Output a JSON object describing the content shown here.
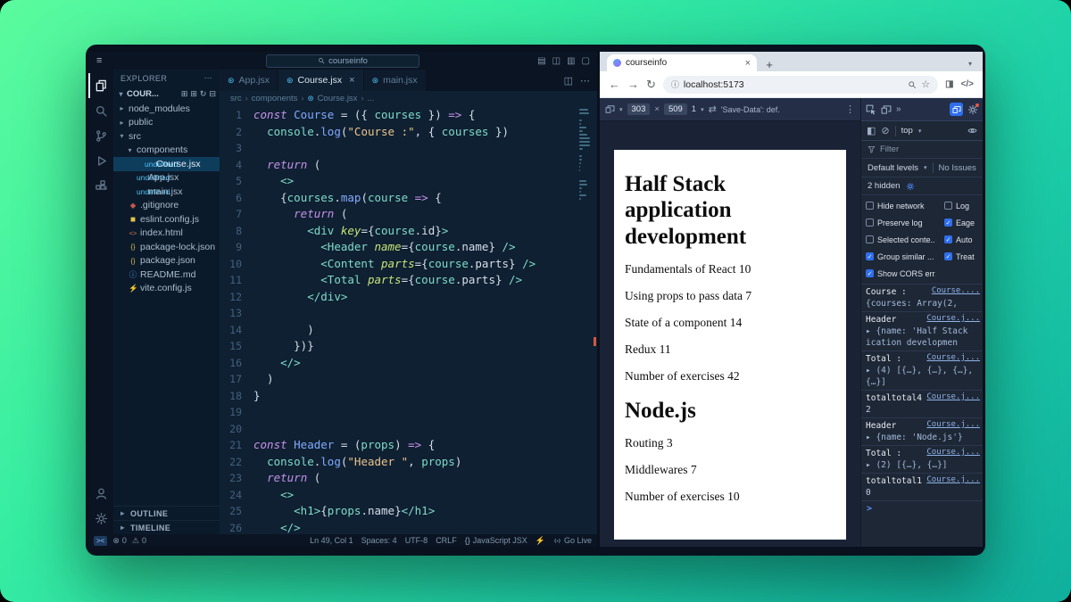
{
  "icons": {
    "menu": "≡",
    "chev_r": "▸",
    "chev_d": "▾",
    "crumb_sep": "›",
    "close": "×",
    "add": "+",
    "more_h": "⋯",
    "more_v": "⋮",
    "split": "◫",
    "layout_a": "▤",
    "layout_b": "◫",
    "layout_c": "▥",
    "layout_d": "▢",
    "back": "←",
    "forward": "→",
    "reload": "↻",
    "site_info": "ⓘ",
    "star": "☆",
    "code": "</>",
    "side_panel": "◨",
    "errors": "⊗",
    "warnings": "⚠",
    "braces": "{}",
    "bolt": "⚡",
    "react": "⊛",
    "x": "×",
    "dbl_arrow": "»",
    "rotate": "⇄",
    "clear": "⊘",
    "sidebar_panel": "◧",
    "remote": "><",
    "new_file": "⊞",
    "new_folder": "⊞",
    "refresh": "↻",
    "collapse": "⊟",
    "file_js": "◼",
    "file_json": "{}",
    "file_html": "<>",
    "file_info": "ⓘ",
    "file_vite": "⚡",
    "file_git": "◆"
  },
  "vscode": {
    "search_text": "courseinfo",
    "activity_top": [
      {
        "name": "files",
        "active": true
      },
      {
        "name": "search"
      },
      {
        "name": "scm"
      },
      {
        "name": "debug"
      },
      {
        "name": "ext"
      }
    ],
    "activity_bottom": [
      {
        "name": "account"
      },
      {
        "name": "gear"
      }
    ],
    "explorer": {
      "title": "EXPLORER",
      "project": "COUR...",
      "tree": [
        {
          "label": "node_modules",
          "indent": 0,
          "chev": "r"
        },
        {
          "label": "public",
          "indent": 0,
          "chev": "r"
        },
        {
          "label": "src",
          "indent": 0,
          "chev": "d"
        },
        {
          "label": "components",
          "indent": 1,
          "chev": "d"
        },
        {
          "label": "Course.jsx",
          "indent": 2,
          "icon": "react",
          "selected": true
        },
        {
          "label": "App.jsx",
          "indent": 1,
          "icon": "react"
        },
        {
          "label": "main.jsx",
          "indent": 1,
          "icon": "react"
        },
        {
          "label": ".gitignore",
          "indent": 0,
          "icon": "git"
        },
        {
          "label": "eslint.config.js",
          "indent": 0,
          "icon": "js"
        },
        {
          "label": "index.html",
          "indent": 0,
          "icon": "html"
        },
        {
          "label": "package-lock.json",
          "indent": 0,
          "icon": "json"
        },
        {
          "label": "package.json",
          "indent": 0,
          "icon": "json"
        },
        {
          "label": "README.md",
          "indent": 0,
          "icon": "info"
        },
        {
          "label": "vite.config.js",
          "indent": 0,
          "icon": "vite"
        }
      ],
      "outline": "OUTLINE",
      "timeline": "TIMELINE"
    },
    "tabs": [
      {
        "label": "App.jsx"
      },
      {
        "label": "Course.jsx",
        "active": true
      },
      {
        "label": "main.jsx"
      }
    ],
    "breadcrumb": [
      {
        "t": "src"
      },
      {
        "t": "components"
      },
      {
        "t": "Course.jsx",
        "icon": "react"
      },
      {
        "t": "..."
      }
    ],
    "code": [
      [
        [
          "k",
          "const "
        ],
        [
          "c",
          "Course"
        ],
        [
          "p",
          " = ({ "
        ],
        [
          "v",
          "courses"
        ],
        [
          "p",
          " }) "
        ],
        [
          "k",
          "=>"
        ],
        [
          "p",
          " {"
        ]
      ],
      [
        [
          "p",
          "  "
        ],
        [
          "v",
          "console"
        ],
        [
          "p",
          "."
        ],
        [
          "f",
          "log"
        ],
        [
          "p",
          "("
        ],
        [
          "s",
          "\"Course :\""
        ],
        [
          "p",
          ", { "
        ],
        [
          "v",
          "courses"
        ],
        [
          "p",
          " })"
        ]
      ],
      [],
      [
        [
          "p",
          "  "
        ],
        [
          "k",
          "return"
        ],
        [
          "p",
          " ("
        ]
      ],
      [
        [
          "p",
          "    "
        ],
        [
          "t",
          "<>"
        ]
      ],
      [
        [
          "p",
          "    {"
        ],
        [
          "v",
          "courses"
        ],
        [
          "p",
          "."
        ],
        [
          "f",
          "map"
        ],
        [
          "p",
          "("
        ],
        [
          "v",
          "course"
        ],
        [
          "p",
          " "
        ],
        [
          "k",
          "=>"
        ],
        [
          "p",
          " {"
        ]
      ],
      [
        [
          "p",
          "      "
        ],
        [
          "k",
          "return"
        ],
        [
          "p",
          " ("
        ]
      ],
      [
        [
          "p",
          "        "
        ],
        [
          "t",
          "<div"
        ],
        [
          "p",
          " "
        ],
        [
          "a",
          "key"
        ],
        [
          "p",
          "={"
        ],
        [
          "v",
          "course"
        ],
        [
          "p",
          ".id}"
        ],
        [
          "t",
          ">"
        ]
      ],
      [
        [
          "p",
          "          "
        ],
        [
          "t",
          "<Header"
        ],
        [
          "p",
          " "
        ],
        [
          "a",
          "name"
        ],
        [
          "p",
          "={"
        ],
        [
          "v",
          "course"
        ],
        [
          "p",
          ".name} "
        ],
        [
          "t",
          "/>"
        ]
      ],
      [
        [
          "p",
          "          "
        ],
        [
          "t",
          "<Content"
        ],
        [
          "p",
          " "
        ],
        [
          "a",
          "parts"
        ],
        [
          "p",
          "={"
        ],
        [
          "v",
          "course"
        ],
        [
          "p",
          ".parts} "
        ],
        [
          "t",
          "/>"
        ]
      ],
      [
        [
          "p",
          "          "
        ],
        [
          "t",
          "<Total"
        ],
        [
          "p",
          " "
        ],
        [
          "a",
          "parts"
        ],
        [
          "p",
          "={"
        ],
        [
          "v",
          "course"
        ],
        [
          "p",
          ".parts} "
        ],
        [
          "t",
          "/>"
        ]
      ],
      [
        [
          "p",
          "        "
        ],
        [
          "t",
          "</div>"
        ]
      ],
      [],
      [
        [
          "p",
          "        )"
        ]
      ],
      [
        [
          "p",
          "      })}"
        ]
      ],
      [
        [
          "p",
          "    "
        ],
        [
          "t",
          "</>"
        ]
      ],
      [
        [
          "p",
          "  )"
        ]
      ],
      [
        [
          "p",
          "}"
        ]
      ],
      [],
      [],
      [
        [
          "k",
          "const "
        ],
        [
          "c",
          "Header"
        ],
        [
          "p",
          " = ("
        ],
        [
          "v",
          "props"
        ],
        [
          "p",
          ") "
        ],
        [
          "k",
          "=>"
        ],
        [
          "p",
          " {"
        ]
      ],
      [
        [
          "p",
          "  "
        ],
        [
          "v",
          "console"
        ],
        [
          "p",
          "."
        ],
        [
          "f",
          "log"
        ],
        [
          "p",
          "("
        ],
        [
          "s",
          "\"Header \""
        ],
        [
          "p",
          ", "
        ],
        [
          "v",
          "props"
        ],
        [
          "p",
          ")"
        ]
      ],
      [
        [
          "p",
          "  "
        ],
        [
          "k",
          "return"
        ],
        [
          "p",
          " ("
        ]
      ],
      [
        [
          "p",
          "    "
        ],
        [
          "t",
          "<>"
        ]
      ],
      [
        [
          "p",
          "      "
        ],
        [
          "t",
          "<h1>"
        ],
        [
          "p",
          "{"
        ],
        [
          "v",
          "props"
        ],
        [
          "p",
          ".name}"
        ],
        [
          "t",
          "</h1>"
        ]
      ],
      [
        [
          "p",
          "    "
        ],
        [
          "t",
          "</>"
        ]
      ]
    ],
    "status": {
      "errors": "0",
      "warnings": "0",
      "right": [
        {
          "t": "Ln 49, Col 1"
        },
        {
          "t": "Spaces: 4"
        },
        {
          "t": "UTF-8"
        },
        {
          "t": "CRLF"
        },
        {
          "icon": "braces",
          "t": "JavaScript JSX"
        },
        {
          "icon": "bolt",
          "t": ""
        },
        {
          "icon": "broadcast",
          "t": "Go Live"
        }
      ]
    }
  },
  "browser": {
    "tab_title": "courseinfo",
    "url": "localhost:5173",
    "device_bar": {
      "width": "303",
      "height": "509",
      "zoom": "1",
      "hint": "'Save-Data': def."
    },
    "page": {
      "heading1": "Half Stack application development",
      "items1": [
        "Fundamentals of React 10",
        "Using props to pass data 7",
        "State of a component 14",
        "Redux 11",
        "Number of exercises 42"
      ],
      "heading2": "Node.js",
      "items2": [
        "Routing 3",
        "Middlewares 7",
        "Number of exercises 10"
      ]
    },
    "devtools": {
      "context": "top",
      "filter_placeholder": "Filter",
      "levels": "Default levels",
      "issues": "No Issues",
      "hidden": "2 hidden",
      "settings": [
        {
          "label": "Hide network",
          "checked": false
        },
        {
          "label": "Log",
          "checked": false
        },
        {
          "label": "Preserve log",
          "checked": false
        },
        {
          "label": "Eage",
          "checked": true
        },
        {
          "label": "Selected conte...",
          "checked": false
        },
        {
          "label": "Auto",
          "checked": true
        },
        {
          "label": "Group similar ...",
          "checked": true
        },
        {
          "label": "Treat",
          "checked": true
        },
        {
          "label": "Show CORS err...",
          "checked": true
        }
      ],
      "messages": [
        {
          "src": "Course....",
          "lines": [
            {
              "t": "Course :",
              "c": "m"
            },
            {
              "t": "{courses: Array(2,",
              "c": "o"
            }
          ]
        },
        {
          "src": "Course.j...",
          "lines": [
            {
              "t": "Header",
              "c": "m"
            },
            {
              "t": "▸ {name: 'Half Stack",
              "c": "o"
            },
            {
              "t": "ication developmen",
              "c": "o"
            }
          ]
        },
        {
          "src": "Course.j...",
          "lines": [
            {
              "t": "Total :",
              "c": "m"
            },
            {
              "t": "▸ (4) [{…}, {…}, {…},",
              "c": "o"
            },
            {
              "t": "{…}]",
              "c": "o"
            }
          ]
        },
        {
          "src": "Course.j...",
          "lines": [
            {
              "t": "totaltotal4",
              "c": "m"
            },
            {
              "t": "2",
              "c": "n"
            }
          ]
        },
        {
          "src": "Course.j...",
          "lines": [
            {
              "t": "Header",
              "c": "m"
            },
            {
              "t": "▸ {name: 'Node.js'}",
              "c": "o"
            }
          ]
        },
        {
          "src": "Course.j...",
          "lines": [
            {
              "t": "Total :",
              "c": "m"
            },
            {
              "t": "▸ (2) [{…}, {…}]",
              "c": "o"
            }
          ]
        },
        {
          "src": "Course.j...",
          "lines": [
            {
              "t": "totaltotal1",
              "c": "m"
            },
            {
              "t": "0",
              "c": "n"
            }
          ]
        }
      ],
      "prompt": ">"
    }
  }
}
